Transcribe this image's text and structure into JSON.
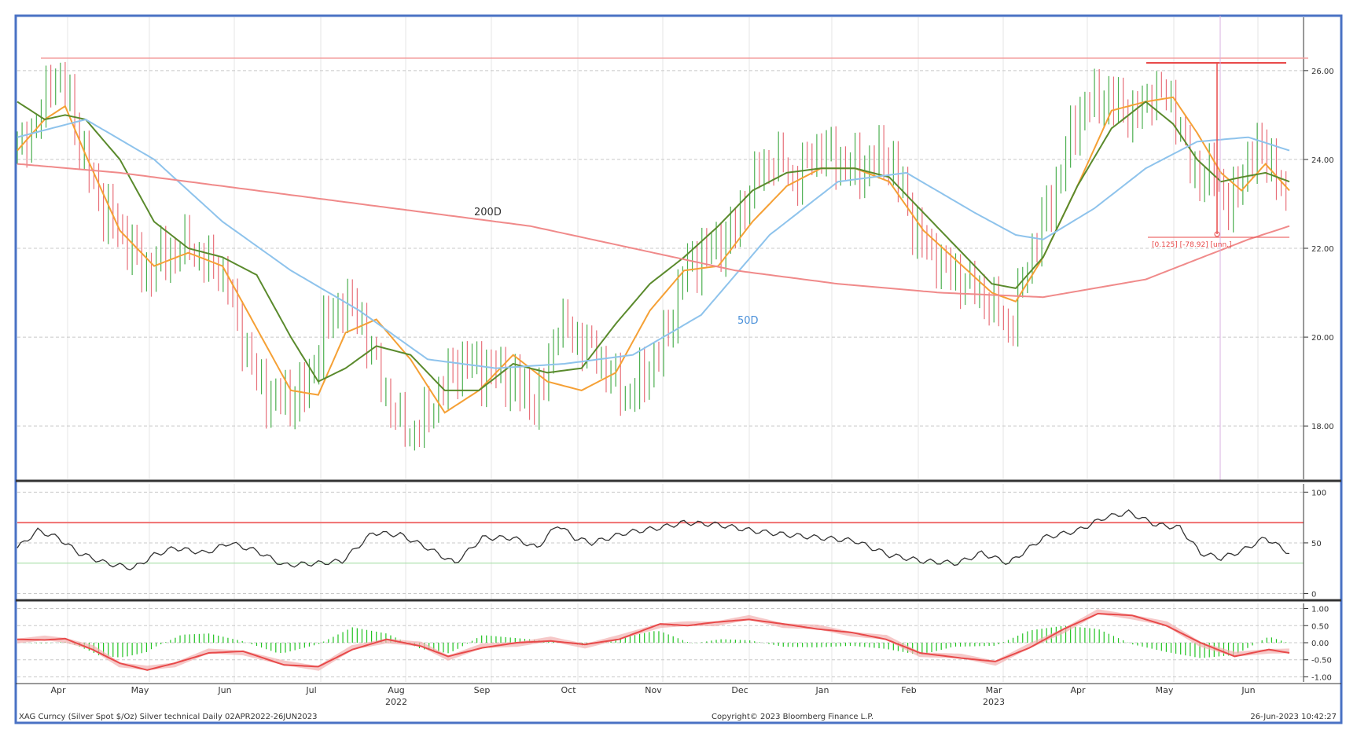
{
  "chart_data": {
    "type": "line",
    "title": "",
    "footer": {
      "left": "XAG Curncy (Silver Spot  $/Oz) Silver technical  Daily 02APR2022-26JUN2023",
      "center": "Copyright© 2023 Bloomberg Finance L.P.",
      "right": "26-Jun-2023 10:42:27"
    },
    "x_axis": {
      "months": [
        "Apr",
        "May",
        "Jun",
        "Jul",
        "Aug",
        "Sep",
        "Oct",
        "Nov",
        "Dec",
        "Jan",
        "Feb",
        "Mar",
        "Apr",
        "May",
        "Jun"
      ],
      "years": [
        "2022",
        "2023"
      ]
    },
    "price_panel": {
      "ylim": [
        16.8,
        27.2
      ],
      "yticks": [
        "18.00",
        "20.00",
        "22.00",
        "24.00",
        "26.00"
      ],
      "ytick_values": [
        18,
        20,
        22,
        24,
        26
      ],
      "annotations": {
        "ma200_label": "200D",
        "ma50_label": "50D",
        "fib_label": "[0.125] [-78.92] [unn.]",
        "resistance_level": 26.2
      },
      "series": [
        {
          "name": "Price",
          "color": "#4caf50",
          "down_color": "#e8707a",
          "x": [
            0,
            6,
            10,
            16,
            20,
            25,
            33,
            38,
            42,
            50,
            55,
            61,
            65,
            70,
            76,
            85,
            90,
            95,
            100,
            104,
            110,
            115,
            122,
            128,
            135,
            145,
            152,
            158,
            165,
            172,
            178,
            183,
            188,
            195,
            200,
            205,
            210,
            217,
            222,
            227,
            235,
            242,
            248,
            255,
            262,
            268,
            275,
            283,
            290,
            298,
            305,
            310
          ],
          "y": [
            24.3,
            24.8,
            26.0,
            25.2,
            23.8,
            22.9,
            22.0,
            21.4,
            21.8,
            22.1,
            21.8,
            21.4,
            20.2,
            19.0,
            18.5,
            18.8,
            20.3,
            20.7,
            20.6,
            19.5,
            18.4,
            17.8,
            18.5,
            19.4,
            19.3,
            19.0,
            18.4,
            20.3,
            20.0,
            19.4,
            18.6,
            19.1,
            19.6,
            21.4,
            21.9,
            22.0,
            22.5,
            23.8,
            24.1,
            23.6,
            24.3,
            23.8,
            23.8,
            24.1,
            22.5,
            21.8,
            21.4,
            21.0,
            20.2,
            22.2,
            23.6,
            25.0
          ],
          "x2": [
            310,
            318,
            326,
            333,
            338,
            343,
            350,
            355,
            360,
            366,
            372
          ],
          "y2": [
            25.0,
            25.4,
            25.0,
            25.6,
            25.4,
            23.8,
            23.6,
            22.9,
            24.0,
            24.2,
            22.5
          ]
        },
        {
          "name": "",
          "color": "#f5a035",
          "x": [
            0,
            8,
            14,
            20,
            30,
            40,
            50,
            60,
            70,
            80,
            88,
            96,
            105,
            115,
            125,
            135,
            145,
            155,
            165,
            175,
            185,
            195,
            205,
            215,
            225,
            235,
            245,
            255,
            265,
            275,
            285,
            292,
            300,
            310,
            320,
            330,
            338,
            345,
            352,
            358,
            365,
            372
          ],
          "y": [
            24.2,
            24.9,
            25.2,
            24.1,
            22.4,
            21.6,
            21.9,
            21.6,
            20.2,
            18.8,
            18.7,
            20.1,
            20.4,
            19.5,
            18.3,
            18.8,
            19.6,
            19.0,
            18.8,
            19.2,
            20.6,
            21.5,
            21.6,
            22.6,
            23.4,
            23.8,
            23.8,
            23.5,
            22.4,
            21.7,
            21.0,
            20.8,
            21.8,
            23.4,
            25.1,
            25.3,
            25.4,
            24.6,
            23.7,
            23.3,
            23.9,
            23.3
          ]
        },
        {
          "name": "",
          "color": "#5a8a2c",
          "x": [
            0,
            8,
            14,
            20,
            30,
            40,
            50,
            60,
            70,
            80,
            88,
            96,
            105,
            115,
            125,
            135,
            145,
            155,
            165,
            175,
            185,
            195,
            205,
            215,
            225,
            235,
            245,
            255,
            265,
            275,
            285,
            292,
            300,
            310,
            320,
            330,
            338,
            345,
            352,
            358,
            365,
            372
          ],
          "y": [
            25.3,
            24.9,
            25.0,
            24.9,
            24.0,
            22.6,
            22.0,
            21.8,
            21.4,
            20.0,
            19.0,
            19.3,
            19.8,
            19.6,
            18.8,
            18.8,
            19.4,
            19.2,
            19.3,
            20.3,
            21.2,
            21.8,
            22.5,
            23.3,
            23.7,
            23.8,
            23.8,
            23.6,
            22.8,
            22.0,
            21.2,
            21.1,
            21.8,
            23.4,
            24.7,
            25.3,
            24.8,
            24.0,
            23.5,
            23.6,
            23.7,
            23.5
          ]
        },
        {
          "name": "",
          "color": "#8ec3ec",
          "x": [
            0,
            20,
            40,
            60,
            80,
            100,
            120,
            140,
            160,
            180,
            200,
            220,
            240,
            260,
            280,
            292,
            300,
            315,
            330,
            345,
            360,
            372
          ],
          "y": [
            24.5,
            24.9,
            24.0,
            22.6,
            21.5,
            20.6,
            19.5,
            19.3,
            19.4,
            19.6,
            20.5,
            22.3,
            23.5,
            23.7,
            22.8,
            22.3,
            22.2,
            22.9,
            23.8,
            24.4,
            24.5,
            24.2
          ]
        },
        {
          "name": "",
          "color": "#f08a8a",
          "x": [
            0,
            30,
            60,
            90,
            120,
            150,
            180,
            210,
            240,
            270,
            300,
            330,
            360,
            372
          ],
          "y": [
            23.9,
            23.7,
            23.4,
            23.1,
            22.8,
            22.5,
            22.0,
            21.5,
            21.2,
            21.0,
            20.9,
            21.3,
            22.2,
            22.5
          ]
        }
      ]
    },
    "rsi_panel": {
      "ylim": [
        -5,
        108
      ],
      "yticks": [
        "0",
        "50",
        "100"
      ],
      "ytick_values": [
        0,
        50,
        100
      ],
      "upper_line": 70,
      "lower_line": 30,
      "x": [
        0,
        6,
        12,
        18,
        26,
        34,
        40,
        46,
        55,
        62,
        70,
        78,
        88,
        95,
        104,
        112,
        120,
        128,
        136,
        145,
        152,
        158,
        163,
        168,
        178,
        188,
        195,
        205,
        215,
        225,
        235,
        245,
        255,
        265,
        275,
        282,
        290,
        300,
        310,
        318,
        325,
        333,
        340,
        346,
        352,
        358,
        365,
        372
      ],
      "y": [
        45,
        62,
        55,
        40,
        30,
        25,
        38,
        45,
        40,
        50,
        42,
        28,
        30,
        32,
        60,
        58,
        45,
        30,
        55,
        55,
        45,
        68,
        55,
        50,
        60,
        65,
        70,
        68,
        62,
        58,
        55,
        52,
        38,
        32,
        30,
        40,
        30,
        55,
        62,
        75,
        80,
        68,
        65,
        40,
        35,
        42,
        55,
        40
      ]
    },
    "macd_panel": {
      "ylim": [
        -1.15,
        1.15
      ],
      "yticks": [
        "1.00",
        "0.50",
        "0.00",
        "-0.50",
        "-1.00"
      ],
      "ytick_values": [
        1.0,
        0.5,
        0.0,
        -0.5,
        -1.0
      ],
      "x": [
        0,
        8,
        14,
        22,
        30,
        38,
        46,
        56,
        66,
        78,
        88,
        98,
        108,
        118,
        126,
        136,
        146,
        156,
        166,
        176,
        188,
        196,
        204,
        214,
        224,
        234,
        244,
        254,
        264,
        276,
        286,
        296,
        306,
        316,
        326,
        336,
        346,
        356,
        366,
        372
      ],
      "y": [
        0.1,
        0.08,
        0.12,
        -0.2,
        -0.6,
        -0.8,
        -0.6,
        -0.3,
        -0.25,
        -0.65,
        -0.7,
        -0.2,
        0.1,
        -0.1,
        -0.4,
        -0.15,
        0.0,
        0.05,
        -0.05,
        0.1,
        0.55,
        0.5,
        0.6,
        0.68,
        0.55,
        0.4,
        0.3,
        0.1,
        -0.3,
        -0.45,
        -0.55,
        -0.15,
        0.4,
        0.85,
        0.8,
        0.5,
        0.0,
        -0.4,
        -0.2,
        -0.3
      ],
      "histogram_color": "#22c322"
    }
  }
}
